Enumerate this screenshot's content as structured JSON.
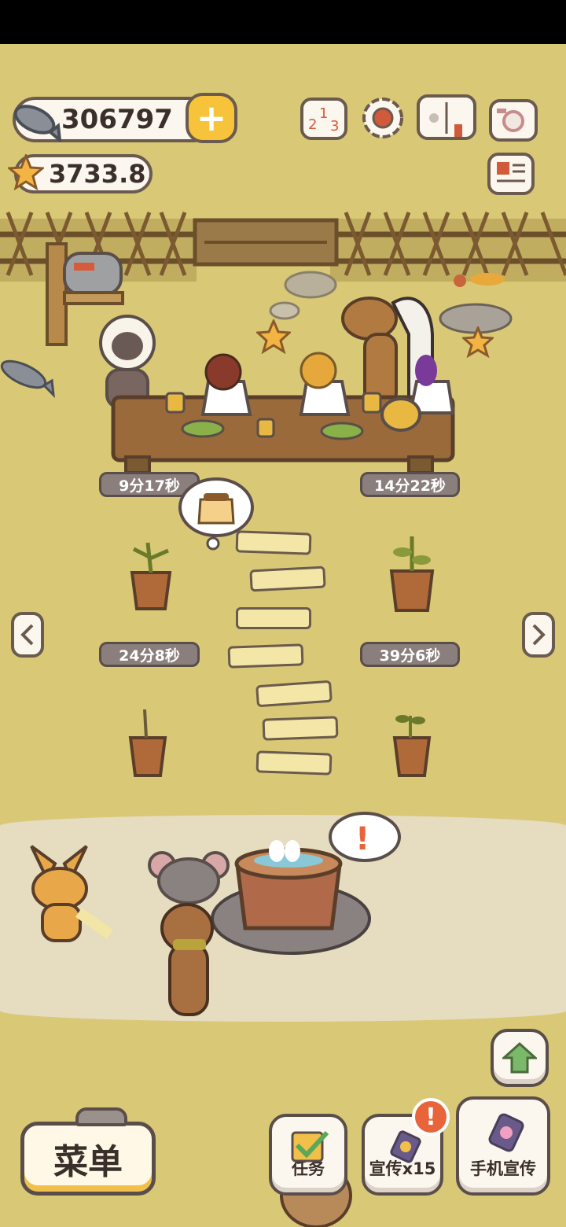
{
  "currency": {
    "fish_count": "306797",
    "star_count": "3733.8"
  },
  "top_icons": [
    "ranking-icon",
    "settings-gear-icon",
    "paw-book-icon",
    "camera-icon",
    "newspaper-icon"
  ],
  "timers": {
    "top_left": "9分17秒",
    "top_right": "14分22秒",
    "middle_left": "24分8秒",
    "middle_right": "39分6秒"
  },
  "bottom_bar": {
    "menu_label": "菜单",
    "task_label": "任务",
    "promote_label": "宣传x15",
    "phone_promote_label": "手机宣传",
    "alert_badge": "!"
  },
  "colors": {
    "accent": "#f7c33a",
    "outline": "#6b5a4e",
    "badge": "#e8643a",
    "timer_bg": "#8a7f7c"
  }
}
